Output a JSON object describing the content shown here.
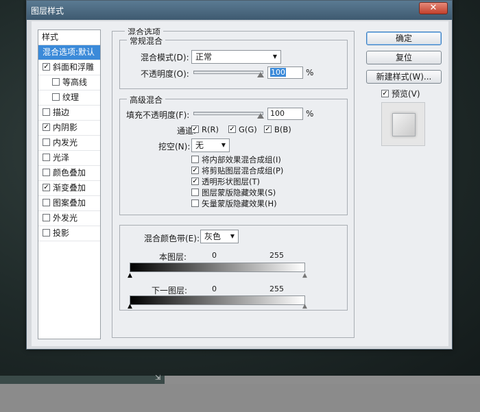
{
  "window": {
    "title": "图层样式",
    "close_glyph": "✕"
  },
  "styles": {
    "header": "样式",
    "items": [
      {
        "label": "混合选项:默认",
        "checkbox": false,
        "checked": false,
        "selected": true,
        "indent": false
      },
      {
        "label": "斜面和浮雕",
        "checkbox": true,
        "checked": true,
        "selected": false,
        "indent": false
      },
      {
        "label": "等高线",
        "checkbox": true,
        "checked": false,
        "selected": false,
        "indent": true
      },
      {
        "label": "纹理",
        "checkbox": true,
        "checked": false,
        "selected": false,
        "indent": true
      },
      {
        "label": "描边",
        "checkbox": true,
        "checked": false,
        "selected": false,
        "indent": false
      },
      {
        "label": "内阴影",
        "checkbox": true,
        "checked": true,
        "selected": false,
        "indent": false
      },
      {
        "label": "内发光",
        "checkbox": true,
        "checked": false,
        "selected": false,
        "indent": false
      },
      {
        "label": "光泽",
        "checkbox": true,
        "checked": false,
        "selected": false,
        "indent": false
      },
      {
        "label": "颜色叠加",
        "checkbox": true,
        "checked": false,
        "selected": false,
        "indent": false
      },
      {
        "label": "渐变叠加",
        "checkbox": true,
        "checked": true,
        "selected": false,
        "indent": false
      },
      {
        "label": "图案叠加",
        "checkbox": true,
        "checked": false,
        "selected": false,
        "indent": false
      },
      {
        "label": "外发光",
        "checkbox": true,
        "checked": false,
        "selected": false,
        "indent": false
      },
      {
        "label": "投影",
        "checkbox": true,
        "checked": false,
        "selected": false,
        "indent": false
      }
    ]
  },
  "blend_options": {
    "title": "混合选项",
    "general": {
      "title": "常规混合",
      "mode_label": "混合模式(D):",
      "mode_value": "正常",
      "opacity_label": "不透明度(O):",
      "opacity_value": "100",
      "opacity_fraction": 1.0,
      "unit": "%"
    },
    "advanced": {
      "title": "高级混合",
      "fill_label": "填充不透明度(F):",
      "fill_value": "100",
      "fill_fraction": 1.0,
      "unit": "%",
      "channels_label": "通道:",
      "channel_r": "R(R)",
      "channel_g": "G(G)",
      "channel_b": "B(B)",
      "knockout_label": "挖空(N):",
      "knockout_value": "无",
      "options": [
        {
          "label": "将内部效果混合成组(I)",
          "checked": false
        },
        {
          "label": "将剪贴图层混合成组(P)",
          "checked": true
        },
        {
          "label": "透明形状图层(T)",
          "checked": true
        },
        {
          "label": "图层蒙版隐藏效果(S)",
          "checked": false
        },
        {
          "label": "矢量蒙版隐藏效果(H)",
          "checked": false
        }
      ]
    },
    "blend_if": {
      "label": "混合颜色带(E):",
      "value": "灰色",
      "this_layer_label": "本图层:",
      "this_min": "0",
      "this_max": "255",
      "underlying_label": "下一图层:",
      "under_min": "0",
      "under_max": "255"
    }
  },
  "buttons": {
    "ok": "确定",
    "reset": "复位",
    "new_style": "新建样式(W)...",
    "preview_label": "预览(V)",
    "preview_checked": true
  },
  "colors": {
    "accent": "#3b8ad9",
    "title_bar": "#4a6a82",
    "close": "#c9503c"
  }
}
